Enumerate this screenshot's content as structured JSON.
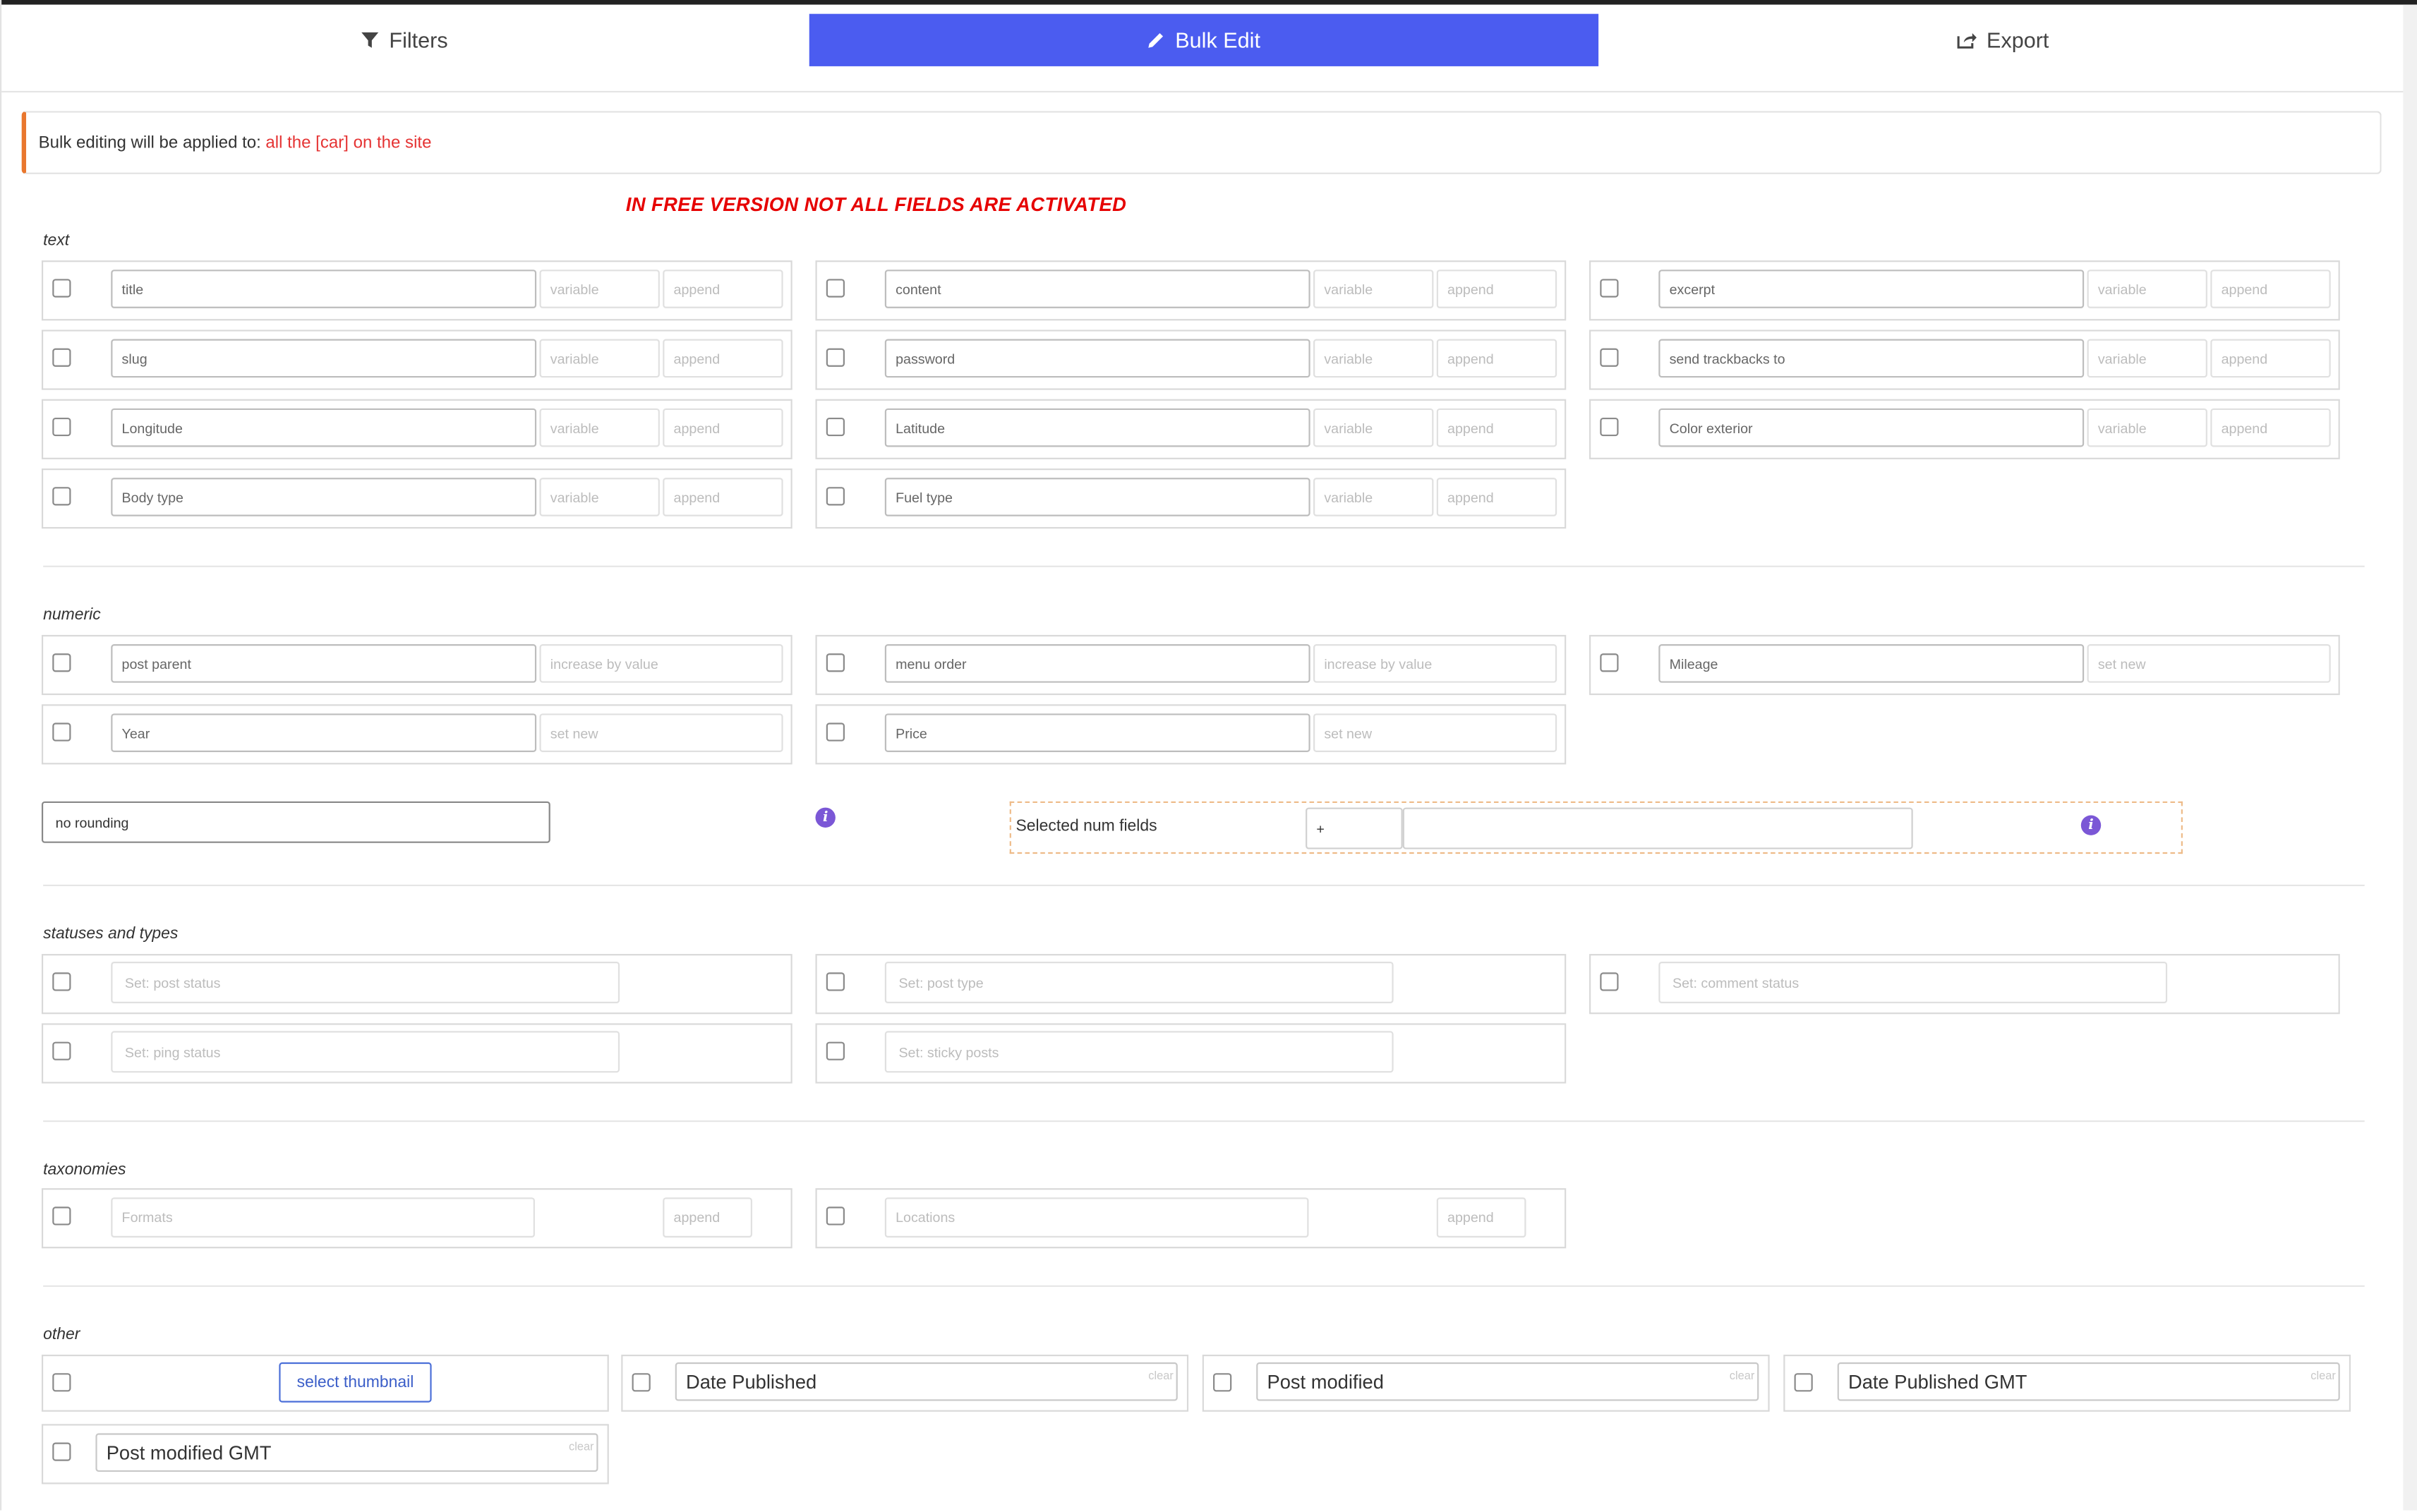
{
  "tabs": {
    "filters": "Filters",
    "bulk_edit": "Bulk Edit",
    "export": "Export"
  },
  "notice": {
    "prefix": "Bulk editing will be applied to:",
    "target": "all the [car] on the site"
  },
  "free_warning": "IN FREE VERSION NOT ALL FIELDS ARE ACTIVATED",
  "sections": {
    "text": "text",
    "numeric": "numeric",
    "statuses": "statuses and types",
    "taxonomies": "taxonomies",
    "other": "other"
  },
  "text_fields": [
    {
      "value": "title",
      "variable": "variable",
      "mode": "append"
    },
    {
      "value": "content",
      "variable": "variable",
      "mode": "append"
    },
    {
      "value": "excerpt",
      "variable": "variable",
      "mode": "append"
    },
    {
      "value": "slug",
      "variable": "variable",
      "mode": "append"
    },
    {
      "value": "password",
      "variable": "variable",
      "mode": "append"
    },
    {
      "value": "send trackbacks to",
      "variable": "variable",
      "mode": "append"
    },
    {
      "value": "Longitude",
      "variable": "variable",
      "mode": "append"
    },
    {
      "value": "Latitude",
      "variable": "variable",
      "mode": "append"
    },
    {
      "value": "Color exterior",
      "variable": "variable",
      "mode": "append"
    },
    {
      "value": "Body type",
      "variable": "variable",
      "mode": "append"
    },
    {
      "value": "Fuel type",
      "variable": "variable",
      "mode": "append"
    }
  ],
  "numeric_fields": [
    {
      "value": "post parent",
      "mode": "increase by value"
    },
    {
      "value": "menu order",
      "mode": "increase by value"
    },
    {
      "value": "Mileage",
      "mode": "set new"
    },
    {
      "value": "Year",
      "mode": "set new"
    },
    {
      "value": "Price",
      "mode": "set new"
    }
  ],
  "rounding": "no rounding",
  "selected_num": {
    "label": "Selected num fields",
    "operator": "+",
    "value": ""
  },
  "status_fields": [
    "Set: post status",
    "Set: post type",
    "Set: comment status",
    "Set: ping status",
    "Set: sticky posts"
  ],
  "taxonomy_fields": [
    {
      "value": "Formats",
      "mode": "append"
    },
    {
      "value": "Locations",
      "mode": "append"
    }
  ],
  "other": {
    "thumbnail_button": "select thumbnail",
    "dates": [
      {
        "value": "Date Published",
        "clear": "clear"
      },
      {
        "value": "Post modified",
        "clear": "clear"
      },
      {
        "value": "Date Published GMT",
        "clear": "clear"
      },
      {
        "value": "Post modified GMT",
        "clear": "clear"
      }
    ]
  },
  "colors": {
    "accent": "#4b5cf0",
    "notice_border": "#e9772e",
    "warning": "#e60000",
    "info": "#7b57d6"
  }
}
